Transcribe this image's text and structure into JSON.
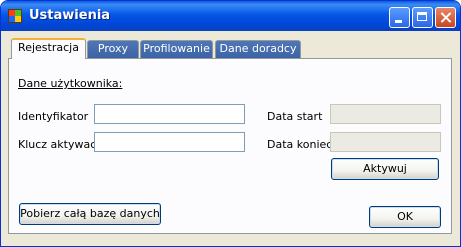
{
  "window": {
    "title": "Ustawienia"
  },
  "icons": {
    "app": "app-icon",
    "minimize": "minimize-icon",
    "maximize": "maximize-icon",
    "close": "close-icon"
  },
  "tabs": [
    {
      "label": "Rejestracja",
      "active": true
    },
    {
      "label": "Proxy",
      "active": false
    },
    {
      "label": "Profilowanie",
      "active": false
    },
    {
      "label": "Dane doradcy",
      "active": false
    }
  ],
  "panel": {
    "section_title": "Dane użytkownika:",
    "fields": {
      "identifier": {
        "label": "Identyfikator",
        "value": ""
      },
      "activation_key": {
        "label": "Klucz aktywacji",
        "value": ""
      },
      "date_start": {
        "label": "Data start",
        "value": ""
      },
      "date_end": {
        "label": "Data koniec",
        "value": ""
      }
    },
    "activate_button": "Aktywuj",
    "download_button": "Pobierz całą bazę danych",
    "ok_button": "OK"
  },
  "colors": {
    "titlebar": "#0a5bdc",
    "window_bg": "#ece9d8",
    "tab_inactive": "#4f77b7",
    "tab_active_accent": "#f5b03a"
  }
}
